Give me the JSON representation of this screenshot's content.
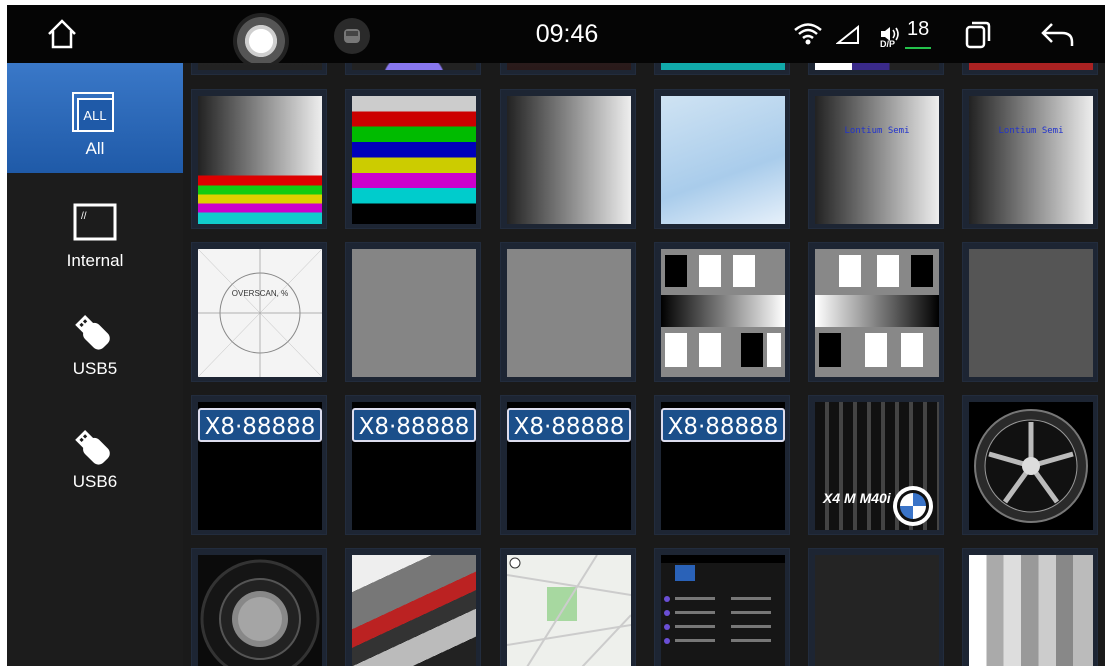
{
  "statusbar": {
    "time": "09:46",
    "volume": "18",
    "volume_mode": "D/P"
  },
  "sidebar": {
    "items": [
      {
        "label": "All",
        "icon": "all-icon",
        "badge": "ALL",
        "active": true
      },
      {
        "label": "Internal",
        "icon": "internal-storage-icon",
        "active": false
      },
      {
        "label": "USB5",
        "icon": "usb-drive-icon",
        "active": false
      },
      {
        "label": "USB6",
        "icon": "usb-drive-icon",
        "active": false
      }
    ]
  },
  "grid": {
    "row1": [
      {
        "type": "grayscale-color-bars"
      },
      {
        "type": "color-bars"
      },
      {
        "type": "grayscale-ramp"
      },
      {
        "type": "light-blue-gradient"
      },
      {
        "type": "lontium-pattern",
        "text": "Lontium Semi"
      },
      {
        "type": "lontium-pattern",
        "text": "Lontium Semi"
      }
    ],
    "row2": [
      {
        "type": "overscan-chart",
        "text": "OVERSCAN, %"
      },
      {
        "type": "gray"
      },
      {
        "type": "gray"
      },
      {
        "type": "contrast-pattern"
      },
      {
        "type": "contrast-pattern-inverse"
      },
      {
        "type": "dark-gray"
      }
    ],
    "row3": [
      {
        "type": "license-plate",
        "text": "X8·88888"
      },
      {
        "type": "license-plate",
        "text": "X8·88888"
      },
      {
        "type": "license-plate",
        "text": "X8·88888"
      },
      {
        "type": "license-plate",
        "text": "X8·88888"
      },
      {
        "type": "bmw-wallpaper",
        "text": "X4 M M40i"
      },
      {
        "type": "wheel-photo"
      }
    ],
    "row4": [
      {
        "type": "speaker-photo"
      },
      {
        "type": "engine-photo"
      },
      {
        "type": "map-screenshot"
      },
      {
        "type": "ui-screenshot"
      },
      {
        "type": "dark-pattern"
      },
      {
        "type": "gray-stripes"
      }
    ]
  },
  "colors": {
    "accent": "#2a6bbf",
    "volume_bar": "#24c24b"
  }
}
